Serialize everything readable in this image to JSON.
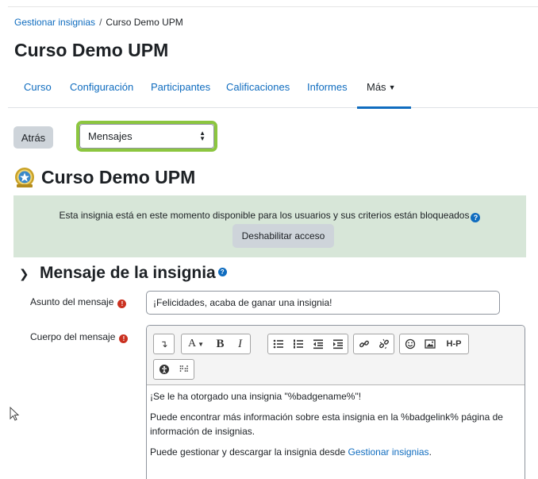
{
  "breadcrumb": {
    "parent": "Gestionar insignias",
    "separator": "/",
    "current": "Curso Demo UPM"
  },
  "page_title": "Curso Demo UPM",
  "tabs": [
    {
      "label": "Curso"
    },
    {
      "label": "Configuración"
    },
    {
      "label": "Participantes"
    },
    {
      "label": "Calificaciones"
    },
    {
      "label": "Informes"
    },
    {
      "label": "Más"
    }
  ],
  "active_tab": "Más",
  "back_button": "Atrás",
  "section_select": {
    "selected": "Mensajes"
  },
  "badge": {
    "title": "Curso Demo UPM",
    "icon": "badge-medal-icon"
  },
  "alert": {
    "text": "Esta insignia está en este momento disponible para los usuarios y sus criterios están bloqueados",
    "button": "Deshabilitar acceso"
  },
  "section": {
    "title": "Mensaje de la insignia"
  },
  "form": {
    "subject_label": "Asunto del mensaje",
    "subject_value": "¡Felicidades, acaba de ganar una insignia!",
    "body_label": "Cuerpo del mensaje"
  },
  "toolbar": {
    "bold": "B",
    "italic": "I",
    "h5p": "H-P",
    "font": "A"
  },
  "body": {
    "p1": "¡Se le ha otorgado una insignia \"%badgename%\"!",
    "p2": "Puede encontrar más información sobre esta insignia en la %badgelink% página de información de insignias.",
    "p3_text": "Puede gestionar y descargar la insignia desde ",
    "p3_link": "Gestionar insignias",
    "p3_end": "."
  },
  "colors": {
    "link": "#0f6cbf",
    "highlight": "#8cc63f",
    "alert_bg": "#d7e6d8",
    "required": "#ca3120"
  }
}
